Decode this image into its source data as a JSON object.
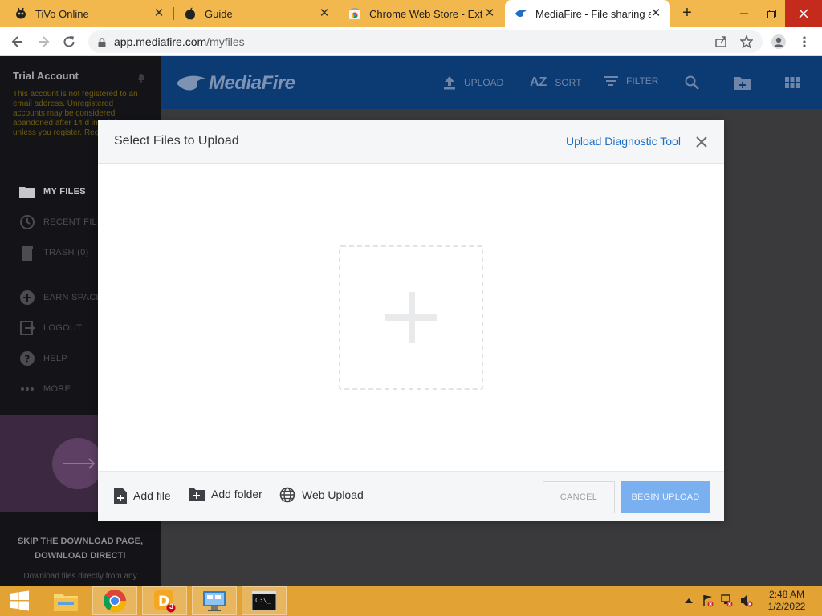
{
  "browser": {
    "tabs": [
      {
        "title": "TiVo Online",
        "icon": "tivo-icon",
        "active": false
      },
      {
        "title": "Guide",
        "icon": "apple-icon",
        "active": false
      },
      {
        "title": "Chrome Web Store - Exten",
        "icon": "chrome-web-store-icon",
        "active": false
      },
      {
        "title": "MediaFire - File sharing an",
        "icon": "mediafire-icon",
        "active": true
      }
    ],
    "url_host": "app.mediafire.com",
    "url_path": "/myfiles"
  },
  "sidebar": {
    "account_title": "Trial Account",
    "notice_text": "This account is not registered to an email address. Unregistered accounts may be considered abandoned after 14 d inactivity, unless you register.",
    "notice_link": "Register no",
    "items": [
      {
        "label": "MY FILES",
        "icon": "folder-icon",
        "active": true
      },
      {
        "label": "RECENT FILE",
        "icon": "clock-icon",
        "active": false
      },
      {
        "label": "TRASH (0)",
        "icon": "trash-icon",
        "active": false
      },
      {
        "label": "EARN SPACE",
        "icon": "plus-circle-icon",
        "active": false
      },
      {
        "label": "LOGOUT",
        "icon": "logout-icon",
        "active": false
      },
      {
        "label": "HELP",
        "icon": "help-icon",
        "active": false
      },
      {
        "label": "MORE",
        "icon": "more-icon",
        "active": false
      }
    ],
    "promo_title_line1": "SKIP THE DOWNLOAD PAGE,",
    "promo_title_line2": "DOWNLOAD DIRECT!",
    "promo_sub": "Download files directly from any"
  },
  "topbar": {
    "logo": "MediaFire",
    "upload": "UPLOAD",
    "sort": "SORT",
    "sort_icon_text": "AZ",
    "filter": "FILTER"
  },
  "modal": {
    "title": "Select Files to Upload",
    "diagnostic_link": "Upload Diagnostic Tool",
    "add_file": "Add file",
    "add_folder": "Add folder",
    "web_upload": "Web Upload",
    "cancel": "CANCEL",
    "begin_upload": "BEGIN UPLOAD"
  },
  "taskbar": {
    "time": "2:48 AM",
    "date": "1/2/2022",
    "badge": "3"
  },
  "colors": {
    "tabstrip": "#f2b84e",
    "mediafire_blue": "#0c3a73",
    "link_blue": "#1f6fc5",
    "begin_button": "#7ab0f0",
    "taskbar": "#e3a234"
  }
}
